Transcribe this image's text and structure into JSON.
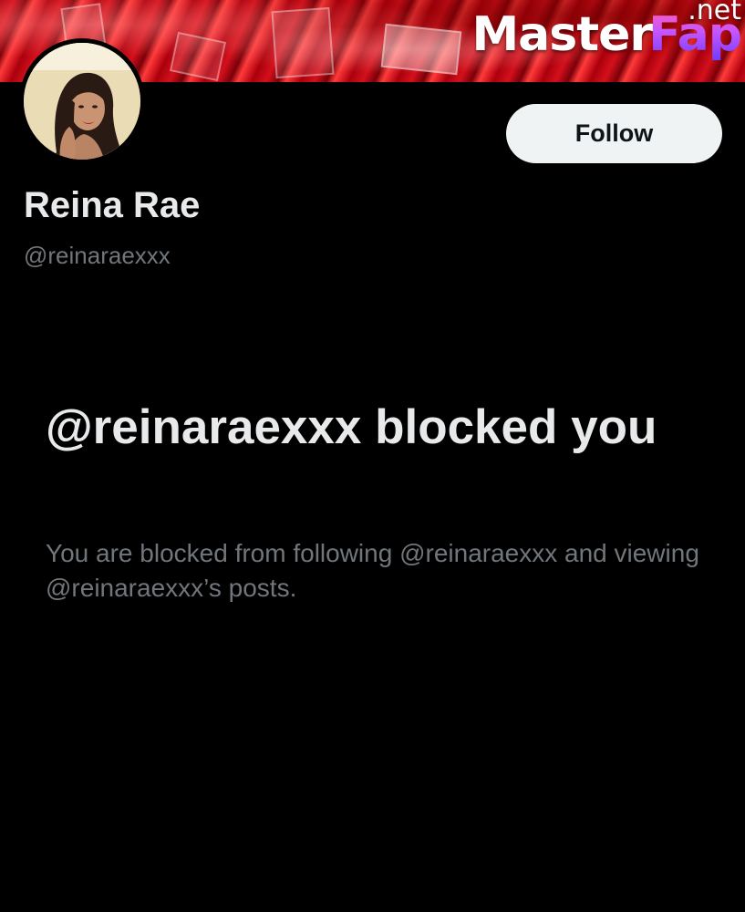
{
  "banner": {
    "accent": "#c0101a"
  },
  "watermark": {
    "brand_main": "Master",
    "brand_accent": "Fap",
    "brand_tld": ".net"
  },
  "profile": {
    "avatar_icon": "profile-photo",
    "display_name": "Reina Rae",
    "handle": "@reinaraexxx",
    "follow_label": "Follow"
  },
  "blocked": {
    "title": "@reinaraexxx blocked you",
    "description": "You are blocked from following @reinaraexxx and viewing @reinaraexxx’s posts."
  },
  "colors": {
    "background": "#000000",
    "primary_text": "#e7e9ea",
    "secondary_text": "#71767b",
    "button_bg": "#eff3f4",
    "button_text": "#0f1419"
  }
}
